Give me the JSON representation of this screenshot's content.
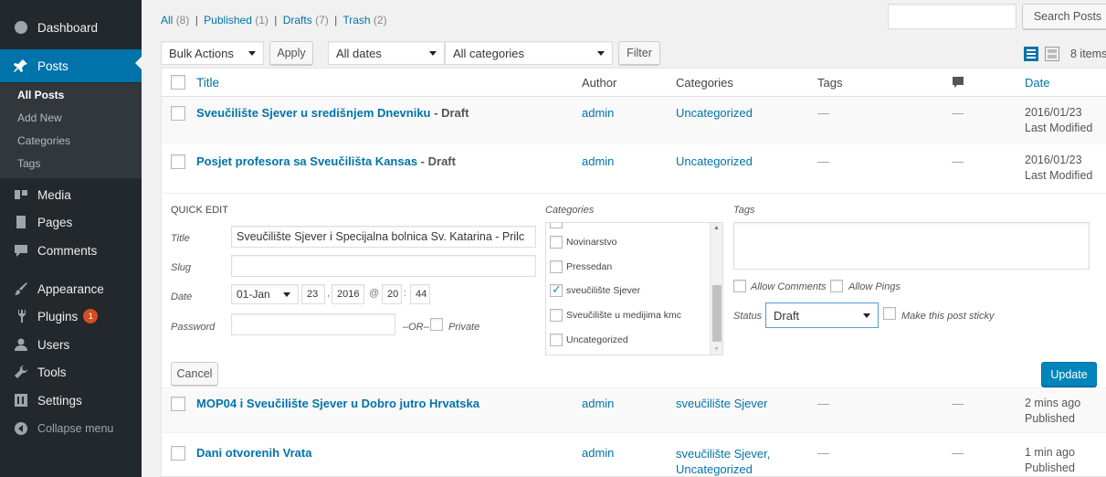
{
  "sidebar": {
    "dashboard": "Dashboard",
    "posts": "Posts",
    "sub_items": [
      "All Posts",
      "Add New",
      "Categories",
      "Tags"
    ],
    "media": "Media",
    "pages": "Pages",
    "comments": "Comments",
    "appearance": "Appearance",
    "plugins": "Plugins",
    "plugins_badge": "1",
    "users": "Users",
    "tools": "Tools",
    "settings": "Settings",
    "collapse": "Collapse menu"
  },
  "filters": {
    "all": "All",
    "all_count": "(8)",
    "published": "Published",
    "published_count": "(1)",
    "drafts": "Drafts",
    "drafts_count": "(7)",
    "trash": "Trash",
    "trash_count": "(2)",
    "sep": "|"
  },
  "toolbar": {
    "bulk_actions": "Bulk Actions",
    "apply": "Apply",
    "all_dates": "All dates",
    "all_categories": "All categories",
    "filter": "Filter",
    "search_button": "Search Posts",
    "items_count": "8 items"
  },
  "table": {
    "headers": {
      "title": "Title",
      "author": "Author",
      "categories": "Categories",
      "tags": "Tags",
      "date": "Date"
    },
    "rows": [
      {
        "title": "Sveučilište Sjever u središnjem Dnevniku",
        "state": " - Draft",
        "author": "admin",
        "categories": "Uncategorized",
        "tags": "—",
        "comments": "—",
        "date": "2016/01/23",
        "status": "Last Modified"
      },
      {
        "title": "Posjet profesora sa Sveučilišta Kansas",
        "state": " - Draft",
        "author": "admin",
        "categories": "Uncategorized",
        "tags": "—",
        "comments": "—",
        "date": "2016/01/23",
        "status": "Last Modified"
      },
      {
        "title": "MOP04 i Sveučilište Sjever u Dobro jutro Hrvatska",
        "state": "",
        "author": "admin",
        "categories": "sveučilište Sjever",
        "tags": "—",
        "comments": "—",
        "date": "2 mins ago",
        "status": "Published"
      },
      {
        "title": "Dani otvorenih Vrata",
        "state": "",
        "author": "admin",
        "categories": "sveučilište Sjever,",
        "categories2": "Uncategorized",
        "tags": "—",
        "comments": "—",
        "date": "1 min ago",
        "status": "Published"
      }
    ]
  },
  "quick_edit": {
    "heading": "QUICK EDIT",
    "title_label": "Title",
    "title_value": "Sveučilište Sjever i Specijalna bolnica Sv. Katarina - Prilc",
    "slug_label": "Slug",
    "slug_value": "",
    "date_label": "Date",
    "month": "01-Jan",
    "day": "23",
    "year": "2016",
    "at": "@",
    "hour": "20",
    "minute": "44",
    "comma": ",",
    "colon": ":",
    "password_label": "Password",
    "or_label": "–OR–",
    "private_label": "Private",
    "categories_heading": "Categories",
    "categories": [
      {
        "label": "Novinarstvo",
        "checked": false
      },
      {
        "label": "Pressedan",
        "checked": false
      },
      {
        "label": "sveučilište Sjever",
        "checked": true
      },
      {
        "label": "Sveučilište u medijima kmc",
        "checked": false
      },
      {
        "label": "Uncategorized",
        "checked": false
      }
    ],
    "tags_heading": "Tags",
    "allow_comments": "Allow Comments",
    "allow_pings": "Allow Pings",
    "status_label": "Status",
    "status_value": "Draft",
    "sticky_label": "Make this post sticky",
    "cancel": "Cancel",
    "update": "Update"
  },
  "colors": {
    "accent": "#0073aa",
    "sidebar": "#23282d",
    "badge": "#d54e21",
    "primary_button": "#0085ba"
  }
}
